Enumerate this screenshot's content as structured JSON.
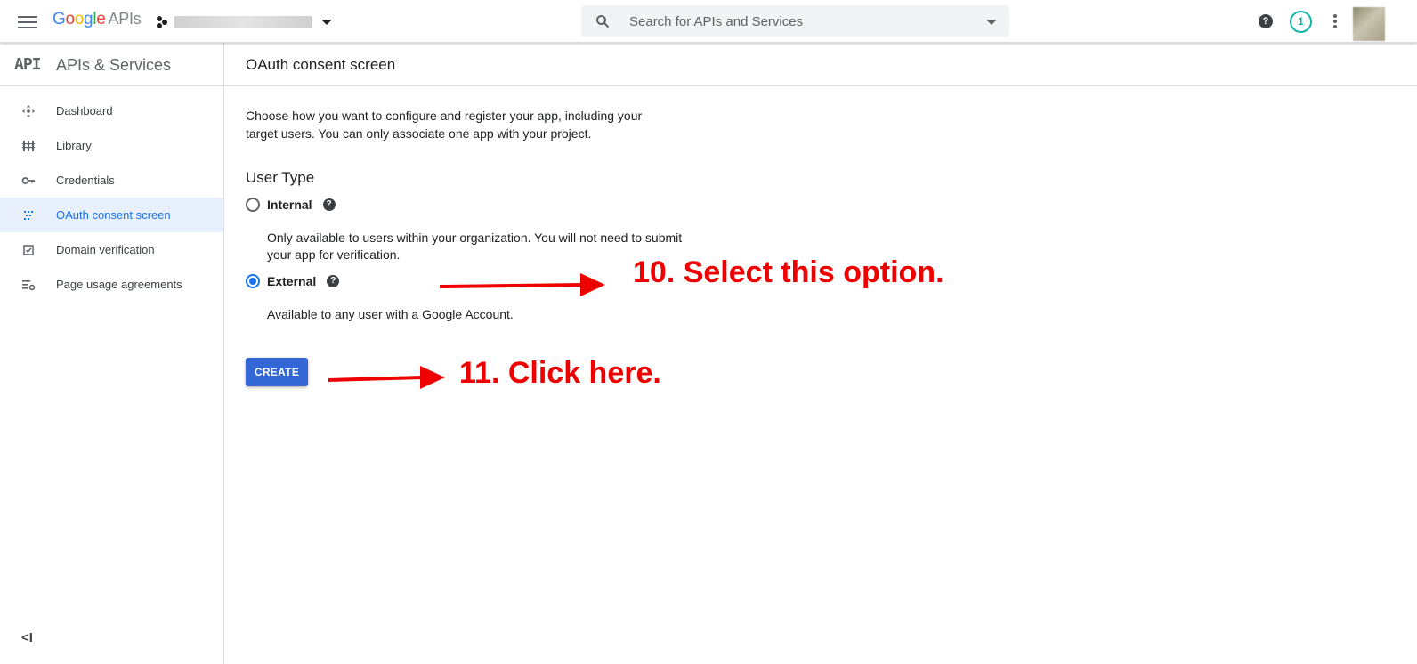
{
  "topbar": {
    "logo_letters": [
      "G",
      "o",
      "o",
      "g",
      "l",
      "e"
    ],
    "logo_suffix": "APIs",
    "search_placeholder": "Search for APIs and Services",
    "help_glyph": "?",
    "notification_count": "1"
  },
  "sidebar": {
    "title": "APIs & Services",
    "api_logo_text": "API",
    "items": [
      {
        "label": "Dashboard",
        "icon": "dashboard-icon"
      },
      {
        "label": "Library",
        "icon": "library-icon"
      },
      {
        "label": "Credentials",
        "icon": "key-icon"
      },
      {
        "label": "OAuth consent screen",
        "icon": "oauth-icon",
        "active": true
      },
      {
        "label": "Domain verification",
        "icon": "checkbox-icon"
      },
      {
        "label": "Page usage agreements",
        "icon": "settings-list-icon"
      }
    ],
    "collapse_glyph": "<I"
  },
  "page": {
    "title": "OAuth consent screen",
    "intro": "Choose how you want to configure and register your app, including your target users. You can only associate one app with your project.",
    "user_type_title": "User Type",
    "options": [
      {
        "label": "Internal",
        "description": "Only available to users within your organization. You will not need to submit your app for verification.",
        "checked": false
      },
      {
        "label": "External",
        "description": "Available to any user with a Google Account.",
        "checked": true
      }
    ],
    "create_label": "CREATE"
  },
  "annotations": {
    "step10": "10. Select this option.",
    "step11": "11. Click here.",
    "color": "#ee0000"
  },
  "colors": {
    "accent": "#1a73e8",
    "button": "#3367d6",
    "active_bg": "#e8f0fe"
  }
}
